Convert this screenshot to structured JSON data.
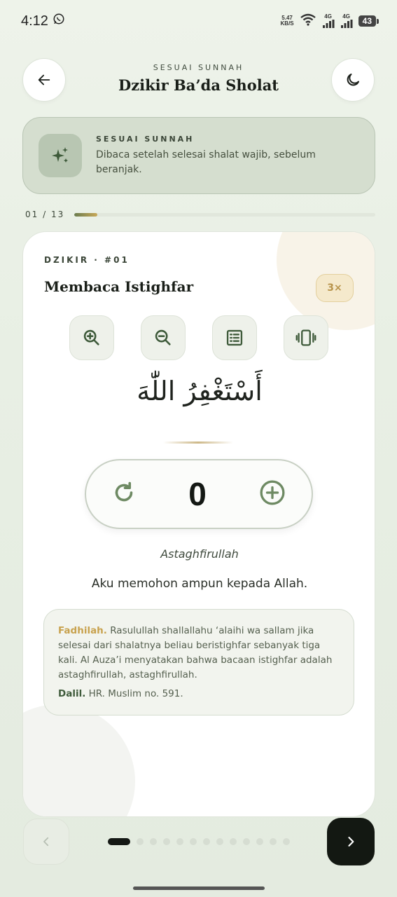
{
  "status_bar": {
    "time": "4:12",
    "speed_value": "5.47",
    "speed_unit": "KB/S",
    "net1": "4G",
    "net2": "4G",
    "battery": "43"
  },
  "header": {
    "overline": "SESUAI SUNNAH",
    "title": "Dzikir Ba’da Sholat"
  },
  "info_card": {
    "kicker": "SESUAI SUNNAH",
    "description": "Dibaca setelah selesai shalat wajib, sebelum beranjak."
  },
  "progress": {
    "label": "01 / 13",
    "current": 1,
    "total": 13
  },
  "dzikir": {
    "label": "DZIKIR · #01",
    "title": "Membaca Istighfar",
    "repeat_badge": "3×",
    "arabic": "أَسْتَغْفِرُ اللّٰهَ",
    "count": "0",
    "latin": "Astaghfirullah",
    "meaning": "Aku memohon ampun kepada Allah.",
    "fadhilah_label": "Fadhilah.",
    "fadhilah_text": " Rasulullah shallallahu ‘alaihi wa sallam jika selesai dari shalatnya beliau beristighfar sebanyak tiga kali. Al Auza’i menyatakan bahwa bacaan istighfar adalah astaghfirullah, astaghfirullah.",
    "dalil_label": "Dalil.",
    "dalil_text": " HR. Muslim no. 591."
  },
  "pager": {
    "total": 13,
    "active_index": 0
  },
  "colors": {
    "accent_gold": "#c8a24e",
    "primary_dark": "#131812",
    "green_icon": "#6e8a63"
  }
}
